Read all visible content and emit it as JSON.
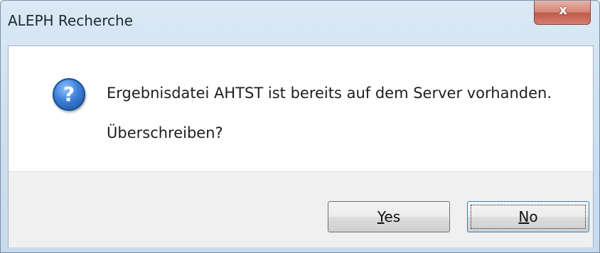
{
  "window": {
    "title": "ALEPH Recherche",
    "close_label": "x"
  },
  "message": {
    "icon": "question-icon",
    "line1": "Ergebnisdatei AHTST ist bereits auf dem Server vorhanden.",
    "line2": "Überschreiben?"
  },
  "buttons": {
    "yes_label": "Yes",
    "no_label": "No",
    "focused": "No"
  },
  "colors": {
    "title_bar": "#cfe1f1",
    "button_bar": "#f0f0f0",
    "close_button": "#c0594a",
    "icon_blue": "#3d7fd8"
  }
}
